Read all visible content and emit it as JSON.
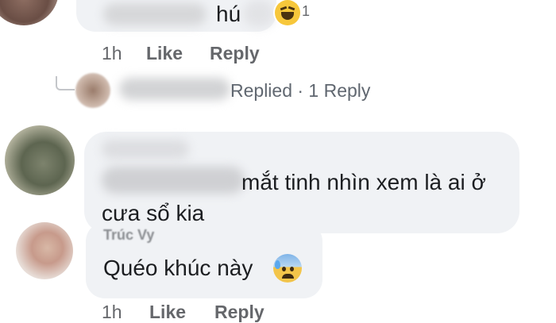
{
  "comments": [
    {
      "text": "hú",
      "reaction": {
        "icon": "laughing-emoji-icon",
        "count": "1"
      },
      "actions": {
        "time": "1h",
        "like": "Like",
        "reply": "Reply"
      }
    },
    {
      "replies_summary": "Replied · 1 Reply"
    },
    {
      "text_line1": "mắt tinh nhìn xem là ai ở",
      "text_line2": "cưa sổ kia"
    },
    {
      "author": "Trúc Vy",
      "text": "Quéo khúc này",
      "emoji": "anxious-sweat-emoji-icon",
      "actions": {
        "time": "1h",
        "like": "Like",
        "reply": "Reply"
      }
    }
  ],
  "colors": {
    "bubble": "#f0f2f5",
    "meta": "#65676b",
    "text": "#1c1e21"
  }
}
